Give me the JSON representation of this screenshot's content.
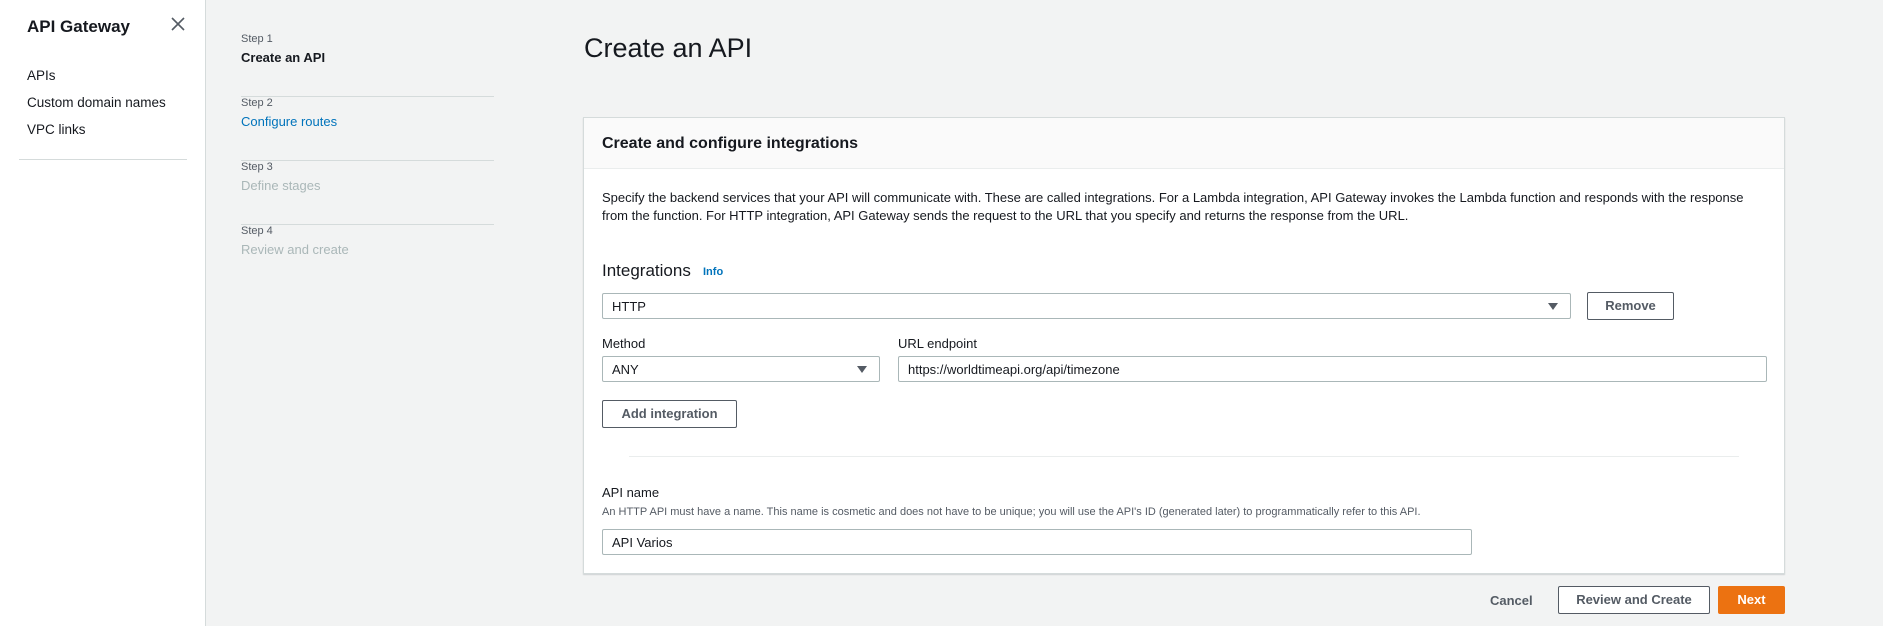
{
  "sidebar": {
    "title": "API Gateway",
    "items": [
      {
        "label": "APIs"
      },
      {
        "label": "Custom domain names"
      },
      {
        "label": "VPC links"
      }
    ]
  },
  "steps": [
    {
      "num": "Step 1",
      "title": "Create an API",
      "state": "current"
    },
    {
      "num": "Step 2",
      "title": "Configure routes",
      "state": "link"
    },
    {
      "num": "Step 3",
      "title": "Define stages",
      "state": "disabled"
    },
    {
      "num": "Step 4",
      "title": "Review and create",
      "state": "disabled"
    }
  ],
  "page_title": "Create an API",
  "panel": {
    "header": "Create and configure integrations",
    "description": "Specify the backend services that your API will communicate with. These are called integrations. For a Lambda integration, API Gateway invokes the Lambda function and responds with the response from the function. For HTTP integration, API Gateway sends the request to the URL that you specify and returns the response from the URL.",
    "integrations_label": "Integrations",
    "info_label": "Info",
    "integration_type": "HTTP",
    "remove_label": "Remove",
    "method_label": "Method",
    "method_value": "ANY",
    "url_label": "URL endpoint",
    "url_value": "https://worldtimeapi.org/api/timezone",
    "add_integration_label": "Add integration",
    "api_name_label": "API name",
    "api_name_help": "An HTTP API must have a name. This name is cosmetic and does not have to be unique; you will use the API's ID (generated later) to programmatically refer to this API.",
    "api_name_value": "API Varios"
  },
  "footer": {
    "cancel_label": "Cancel",
    "review_label": "Review and Create",
    "next_label": "Next"
  },
  "colors": {
    "accent": "#ec7211",
    "link": "#0073bb",
    "background": "#f2f3f3"
  }
}
